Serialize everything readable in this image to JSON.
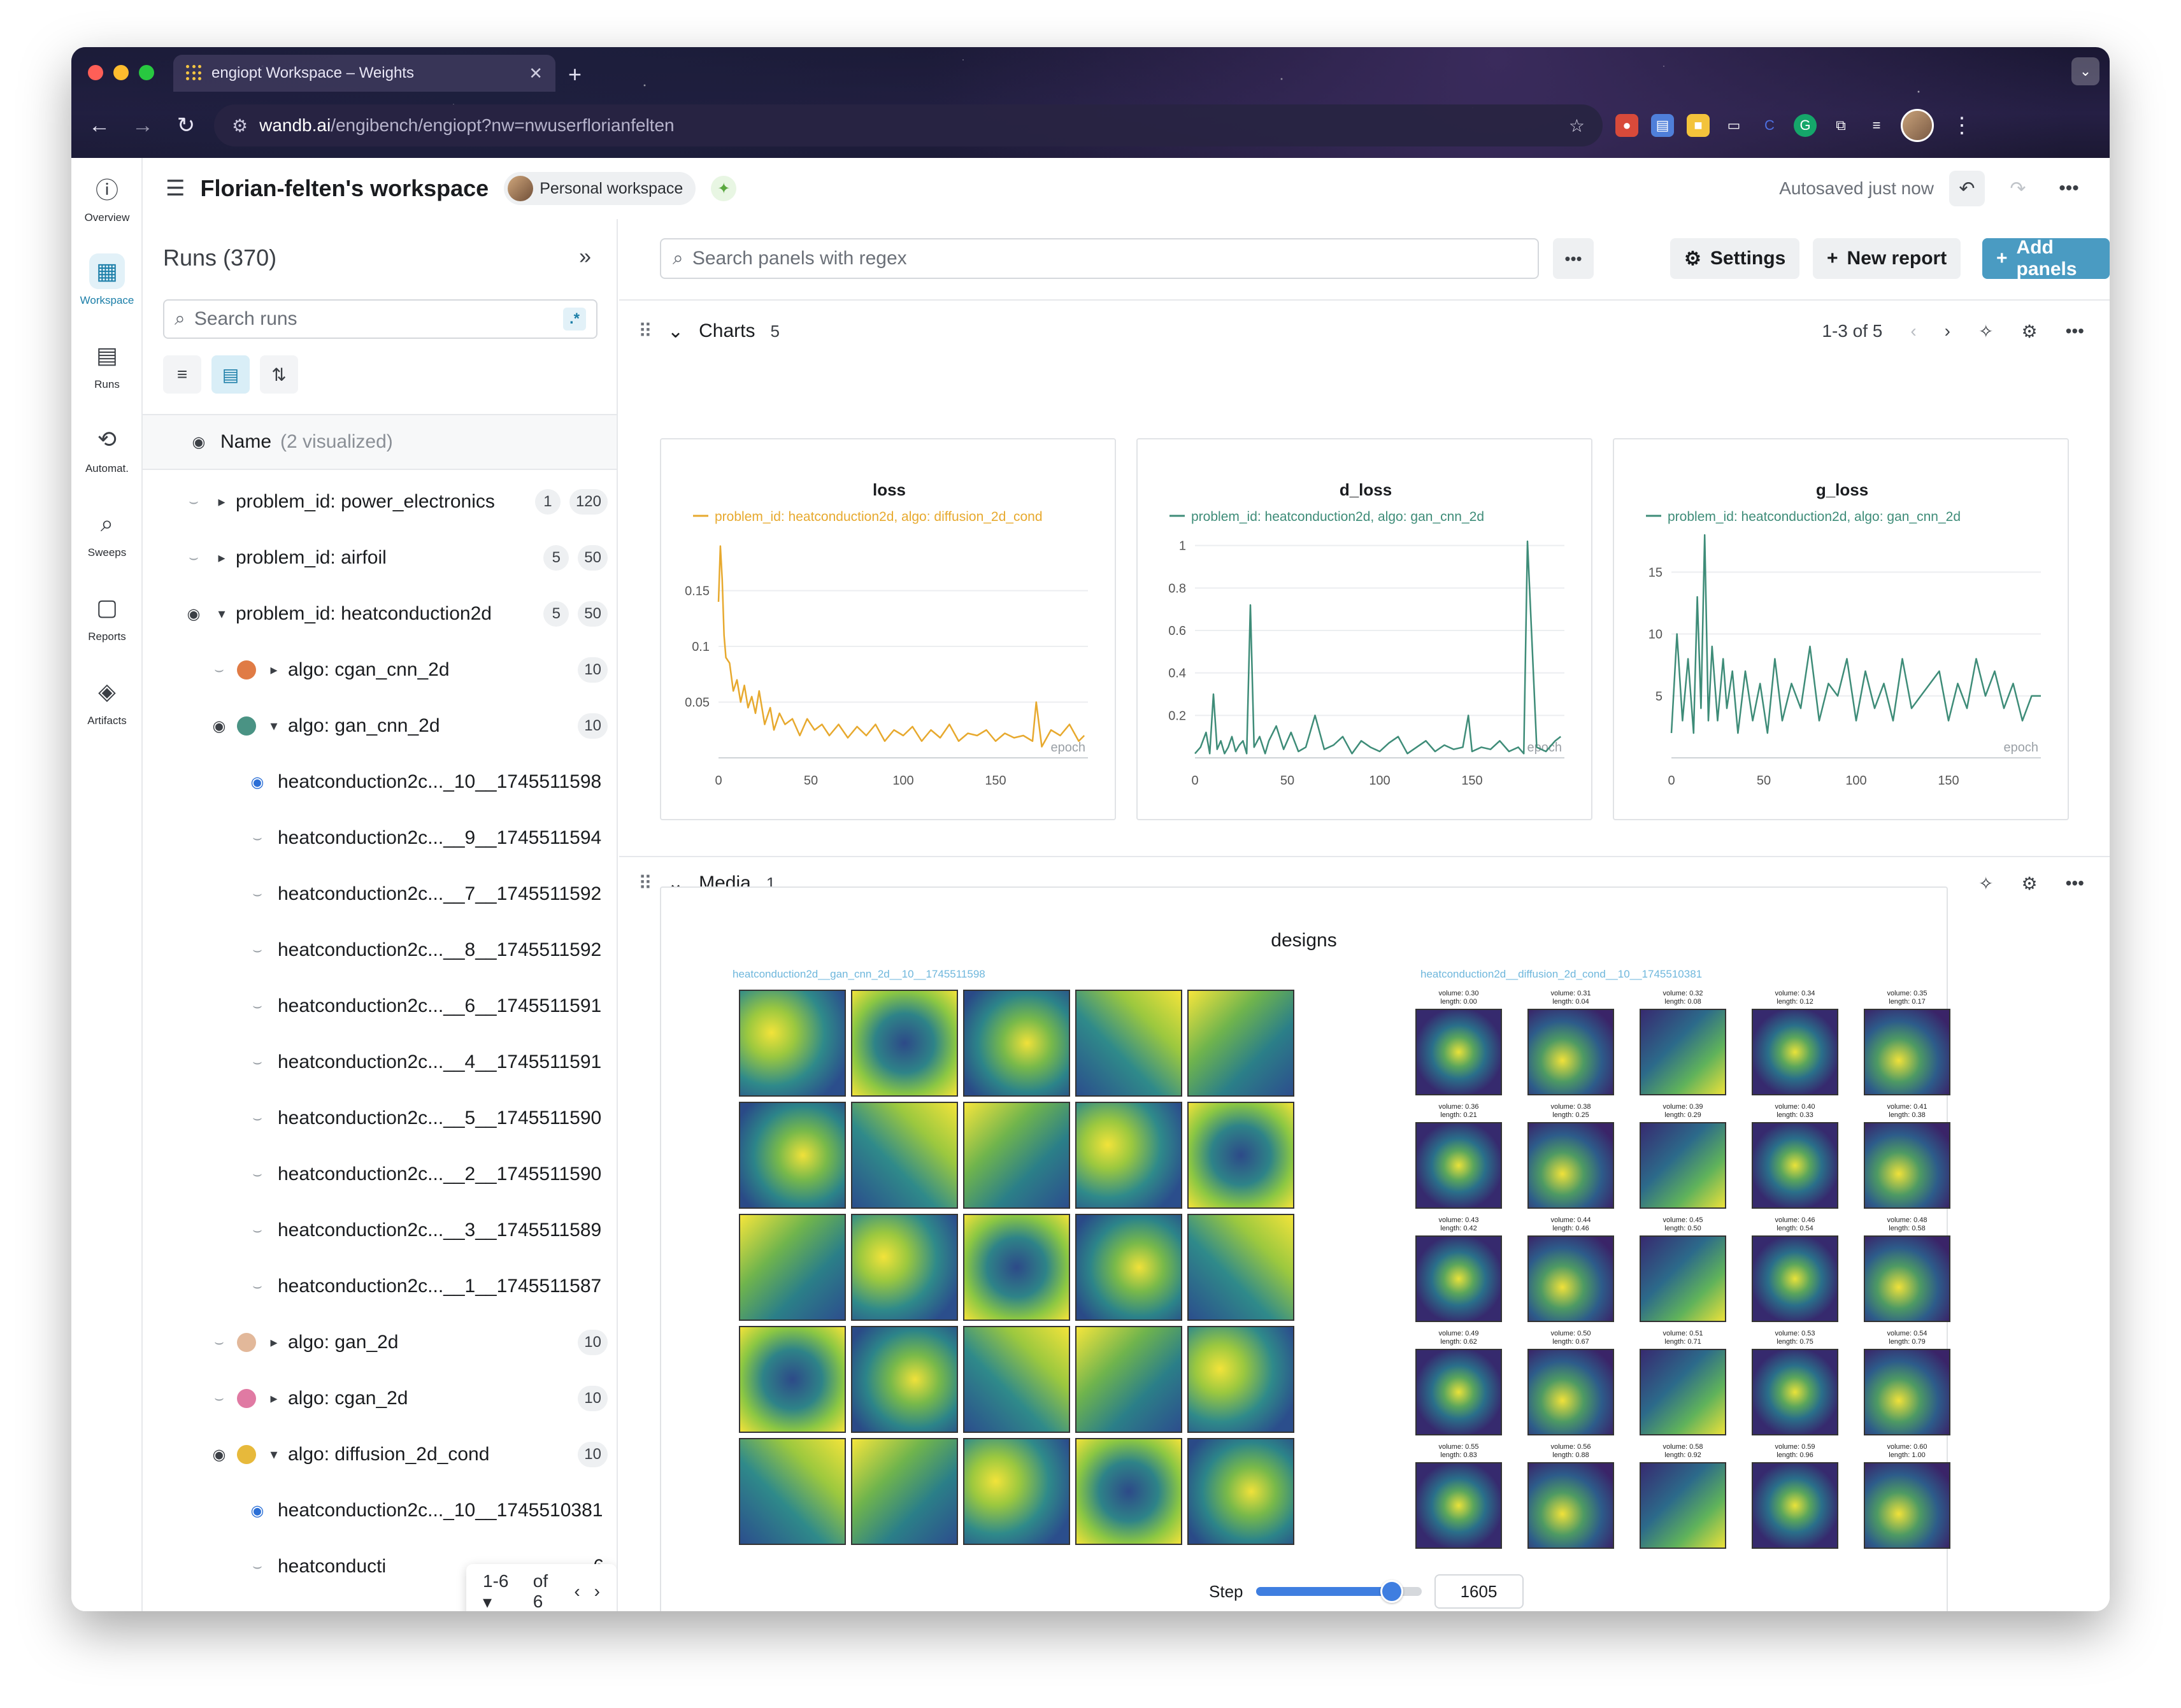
{
  "browser": {
    "tab_title": "engiopt Workspace – Weights",
    "url_host": "wandb.ai",
    "url_path": "/engibench/engiopt?nw=nwuserflorianfelten"
  },
  "nav": {
    "items": [
      {
        "label": "Overview",
        "icon": "info-icon"
      },
      {
        "label": "Workspace",
        "icon": "workspace-icon"
      },
      {
        "label": "Runs",
        "icon": "table-icon"
      },
      {
        "label": "Automat.",
        "icon": "automation-icon"
      },
      {
        "label": "Sweeps",
        "icon": "broom-icon"
      },
      {
        "label": "Reports",
        "icon": "clipboard-icon"
      },
      {
        "label": "Artifacts",
        "icon": "layers-icon"
      }
    ]
  },
  "header": {
    "title": "Florian-felten's workspace",
    "workspace_type": "Personal workspace",
    "autosave": "Autosaved just now"
  },
  "runs": {
    "header": "Runs (370)",
    "search_placeholder": "Search runs",
    "regex_chip": ".*",
    "name_column": "Name",
    "name_visualized": "(2 visualized)",
    "rows": [
      {
        "label": "problem_id: power_electronics",
        "badges": [
          "1",
          "120"
        ]
      },
      {
        "label": "problem_id: airfoil",
        "badges": [
          "5",
          "50"
        ]
      },
      {
        "label": "problem_id: heatconduction2d",
        "badges": [
          "5",
          "50"
        ]
      },
      {
        "label": "algo: cgan_cnn_2d",
        "badges": [
          "10"
        ],
        "color": "#e07b45"
      },
      {
        "label": "algo: gan_cnn_2d",
        "badges": [
          "10"
        ],
        "color": "#4a9384"
      },
      {
        "label": "heatconduction2c..._10__1745511598"
      },
      {
        "label": "heatconduction2c...__9__1745511594"
      },
      {
        "label": "heatconduction2c...__7__1745511592"
      },
      {
        "label": "heatconduction2c...__8__1745511592"
      },
      {
        "label": "heatconduction2c...__6__1745511591"
      },
      {
        "label": "heatconduction2c...__4__1745511591"
      },
      {
        "label": "heatconduction2c...__5__1745511590"
      },
      {
        "label": "heatconduction2c...__2__1745511590"
      },
      {
        "label": "heatconduction2c...__3__1745511589"
      },
      {
        "label": "heatconduction2c...__1__1745511587"
      },
      {
        "label": "algo: gan_2d",
        "badges": [
          "10"
        ],
        "color": "#e2b89a"
      },
      {
        "label": "algo: cgan_2d",
        "badges": [
          "10"
        ],
        "color": "#e07aa3"
      },
      {
        "label": "algo: diffusion_2d_cond",
        "badges": [
          "10"
        ],
        "color": "#e7b93b"
      },
      {
        "label": "heatconduction2c..._10__1745510381"
      },
      {
        "label": "heatconducti",
        "tail": "6"
      }
    ],
    "pager": {
      "range": "1-6",
      "of": "of 6"
    }
  },
  "main": {
    "search_placeholder": "Search panels with regex",
    "settings_label": "Settings",
    "new_report_label": "New report",
    "add_panels_label": "Add panels",
    "charts_section": {
      "title": "Charts",
      "count": "5",
      "paging": "1-3 of 5"
    },
    "media_section": {
      "title": "Media",
      "count": "1"
    },
    "media": {
      "title": "designs",
      "left_caption": "heatconduction2d__gan_cnn_2d__10__1745511598",
      "right_caption": "heatconduction2d__diffusion_2d_cond__10__1745510381",
      "right_labels": [
        [
          "volume: 0.30",
          "length: 0.00"
        ],
        [
          "volume: 0.31",
          "length: 0.04"
        ],
        [
          "volume: 0.32",
          "length: 0.08"
        ],
        [
          "volume: 0.34",
          "length: 0.12"
        ],
        [
          "volume: 0.35",
          "length: 0.17"
        ],
        [
          "volume: 0.36",
          "length: 0.21"
        ],
        [
          "volume: 0.38",
          "length: 0.25"
        ],
        [
          "volume: 0.39",
          "length: 0.29"
        ],
        [
          "volume: 0.40",
          "length: 0.33"
        ],
        [
          "volume: 0.41",
          "length: 0.38"
        ],
        [
          "volume: 0.43",
          "length: 0.42"
        ],
        [
          "volume: 0.44",
          "length: 0.46"
        ],
        [
          "volume: 0.45",
          "length: 0.50"
        ],
        [
          "volume: 0.46",
          "length: 0.54"
        ],
        [
          "volume: 0.48",
          "length: 0.58"
        ],
        [
          "volume: 0.49",
          "length: 0.62"
        ],
        [
          "volume: 0.50",
          "length: 0.67"
        ],
        [
          "volume: 0.51",
          "length: 0.71"
        ],
        [
          "volume: 0.53",
          "length: 0.75"
        ],
        [
          "volume: 0.54",
          "length: 0.79"
        ],
        [
          "volume: 0.55",
          "length: 0.83"
        ],
        [
          "volume: 0.56",
          "length: 0.88"
        ],
        [
          "volume: 0.58",
          "length: 0.92"
        ],
        [
          "volume: 0.59",
          "length: 0.96"
        ],
        [
          "volume: 0.60",
          "length: 1.00"
        ]
      ],
      "step_label": "Step",
      "step_value": "1605",
      "step_fraction": 0.82
    }
  },
  "chart_data": [
    {
      "type": "line",
      "title": "loss",
      "xlabel": "epoch",
      "legend": "problem_id: heatconduction2d, algo: diffusion_2d_cond",
      "color": "#e7a92e",
      "xlim": [
        0,
        200
      ],
      "ylim": [
        0,
        0.2
      ],
      "xticks": [
        0,
        50,
        100,
        150
      ],
      "yticks": [
        0.05,
        0.1,
        0.15
      ],
      "x": [
        0,
        1,
        2,
        3,
        4,
        6,
        8,
        10,
        12,
        14,
        16,
        18,
        20,
        22,
        25,
        28,
        30,
        33,
        36,
        40,
        44,
        48,
        52,
        56,
        60,
        65,
        70,
        75,
        80,
        85,
        90,
        95,
        100,
        105,
        110,
        115,
        120,
        125,
        130,
        135,
        140,
        145,
        150,
        155,
        160,
        165,
        170,
        172,
        175,
        180,
        185,
        190,
        195,
        198
      ],
      "y": [
        0.14,
        0.19,
        0.16,
        0.11,
        0.09,
        0.085,
        0.06,
        0.07,
        0.05,
        0.065,
        0.045,
        0.055,
        0.04,
        0.06,
        0.03,
        0.045,
        0.025,
        0.04,
        0.03,
        0.035,
        0.02,
        0.035,
        0.025,
        0.03,
        0.02,
        0.03,
        0.018,
        0.028,
        0.02,
        0.03,
        0.015,
        0.025,
        0.02,
        0.028,
        0.015,
        0.025,
        0.018,
        0.03,
        0.015,
        0.022,
        0.02,
        0.025,
        0.015,
        0.022,
        0.018,
        0.02,
        0.015,
        0.05,
        0.01,
        0.025,
        0.02,
        0.03,
        0.015,
        0.02
      ]
    },
    {
      "type": "line",
      "title": "d_loss",
      "xlabel": "epoch",
      "legend": "problem_id: heatconduction2d, algo: gan_cnn_2d",
      "color": "#3e8c78",
      "xlim": [
        0,
        200
      ],
      "ylim": [
        0,
        1.05
      ],
      "xticks": [
        0,
        50,
        100,
        150
      ],
      "yticks": [
        0.2,
        0.4,
        0.6,
        0.8,
        1
      ],
      "x": [
        0,
        3,
        6,
        8,
        10,
        12,
        14,
        16,
        18,
        20,
        22,
        24,
        26,
        28,
        30,
        32,
        35,
        38,
        40,
        44,
        48,
        52,
        56,
        60,
        65,
        70,
        75,
        80,
        85,
        90,
        95,
        100,
        105,
        110,
        115,
        120,
        125,
        130,
        135,
        140,
        145,
        148,
        150,
        155,
        160,
        165,
        170,
        175,
        178,
        180,
        185,
        190,
        195,
        198
      ],
      "y": [
        0.02,
        0.05,
        0.12,
        0.02,
        0.3,
        0.04,
        0.08,
        0.02,
        0.05,
        0.1,
        0.03,
        0.06,
        0.08,
        0.02,
        0.72,
        0.05,
        0.1,
        0.02,
        0.08,
        0.15,
        0.04,
        0.12,
        0.03,
        0.05,
        0.2,
        0.04,
        0.06,
        0.1,
        0.02,
        0.08,
        0.05,
        0.03,
        0.07,
        0.1,
        0.02,
        0.05,
        0.08,
        0.03,
        0.06,
        0.04,
        0.05,
        0.2,
        0.03,
        0.05,
        0.04,
        0.08,
        0.03,
        0.05,
        0.02,
        1.02,
        0.05,
        0.03,
        0.08,
        0.1
      ]
    },
    {
      "type": "line",
      "title": "g_loss",
      "xlabel": "epoch",
      "legend": "problem_id: heatconduction2d, algo: gan_cnn_2d",
      "color": "#3e8c78",
      "xlim": [
        0,
        200
      ],
      "ylim": [
        0,
        18
      ],
      "xticks": [
        0,
        50,
        100,
        150
      ],
      "yticks": [
        5,
        10,
        15
      ],
      "x": [
        0,
        3,
        6,
        9,
        12,
        14,
        16,
        18,
        20,
        22,
        25,
        28,
        30,
        33,
        36,
        40,
        44,
        48,
        52,
        56,
        60,
        65,
        70,
        75,
        80,
        85,
        90,
        95,
        100,
        105,
        110,
        115,
        120,
        125,
        130,
        135,
        140,
        145,
        150,
        155,
        160,
        165,
        170,
        175,
        180,
        185,
        190,
        195,
        200
      ],
      "y": [
        2,
        10,
        3,
        8,
        2,
        13,
        4,
        18,
        3,
        9,
        3,
        8,
        4,
        7,
        2,
        7,
        3,
        6,
        2,
        8,
        3,
        6,
        4,
        9,
        3,
        6,
        5,
        8,
        3,
        7,
        4,
        6,
        3,
        8,
        4,
        5,
        6,
        7,
        3,
        6,
        4,
        8,
        5,
        7,
        4,
        6,
        3,
        5,
        5
      ]
    }
  ],
  "colors": {
    "accent": "#1b7ea8",
    "primary_button": "#4a9bc2",
    "slider": "#3f7ee0"
  }
}
